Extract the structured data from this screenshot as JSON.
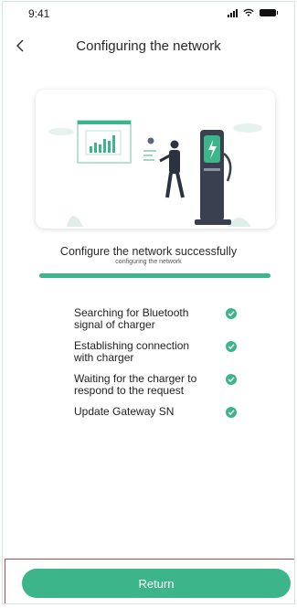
{
  "status_bar": {
    "time": "9:41"
  },
  "header": {
    "title": "Configuring the network"
  },
  "status": {
    "message": "Configure the network successfully",
    "sub_message": "configuring the network",
    "progress": 1.0
  },
  "steps": [
    {
      "label": "Searching for Bluetooth signal of charger",
      "done": true
    },
    {
      "label": "Establishing connection with charger",
      "done": true
    },
    {
      "label": "Waiting for the charger to respond to the request",
      "done": true
    },
    {
      "label": "Update Gateway SN",
      "done": true
    }
  ],
  "footer": {
    "return_label": "Return"
  },
  "colors": {
    "accent": "#3db58a",
    "highlight_border": "#e03a3a"
  }
}
